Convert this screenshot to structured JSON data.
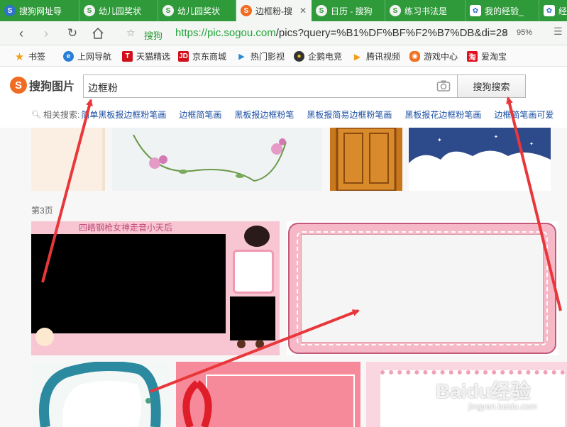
{
  "tabs": [
    {
      "label": "搜狗网址导",
      "icon": "sogou-icon",
      "active": false
    },
    {
      "label": "幼儿园奖状",
      "icon": "sogou-icon",
      "active": false
    },
    {
      "label": "幼儿园奖状",
      "icon": "sogou-icon",
      "active": false
    },
    {
      "label": "边框粉-搜",
      "icon": "sogou-icon",
      "active": true
    },
    {
      "label": "日历 - 搜狗",
      "icon": "sogou-icon",
      "active": false
    },
    {
      "label": "练习书法是",
      "icon": "sogou-icon",
      "active": false
    },
    {
      "label": "我的经验_",
      "icon": "baidu-paw-icon",
      "active": false
    },
    {
      "label": "经",
      "icon": "baidu-paw-icon",
      "active": false
    }
  ],
  "address": {
    "site_name": "搜狗",
    "url_host": "https://pic.sogou.com",
    "url_path": "/pics?query=%B1%DF%BF%F2%B7%DB&di=28",
    "zoom": "95%"
  },
  "bookmarks": [
    {
      "label": "书签",
      "icon": "star-icon",
      "color": "#f0a020"
    },
    {
      "label": "上网导航",
      "icon": "e-icon",
      "color": "#2a7fd4"
    },
    {
      "label": "天猫精选",
      "icon": "tmall-icon",
      "color": "#d0101a"
    },
    {
      "label": "京东商城",
      "icon": "jd-icon",
      "color": "#d0101a"
    },
    {
      "label": "热门影视",
      "icon": "play-icon",
      "color": "#2a8ad4"
    },
    {
      "label": "企鹅电竞",
      "icon": "penguin-icon",
      "color": "#222222"
    },
    {
      "label": "腾讯视频",
      "icon": "tencent-video-icon",
      "color": "#f0a020"
    },
    {
      "label": "游戏中心",
      "icon": "game-icon",
      "color": "#f07020"
    },
    {
      "label": "爱淘宝",
      "icon": "taobao-icon",
      "color": "#e01020"
    }
  ],
  "logo": {
    "mark": "S",
    "text": "搜狗图片"
  },
  "search": {
    "value": "边框粉",
    "button_label": "搜狗搜索"
  },
  "related": {
    "label": "相关搜索:",
    "links": [
      "简单黑板报边框粉笔画",
      "边框简笔画",
      "黑板报边框粉笔",
      "黑板报简易边框粉笔画",
      "黑板报花边框粉笔画",
      "边框简笔画可爱"
    ]
  },
  "page_label": "第3页",
  "thumb_banner_text": "四皓钢枪女神走音小天后",
  "watermark": {
    "main": "Baidu经验",
    "sub": "jingyan.baidu.com"
  },
  "colors": {
    "tabbar": "#2f9a3a",
    "url_green": "#22a33a",
    "arrow_red": "#e8373a",
    "link_blue": "#1a4ea3"
  }
}
